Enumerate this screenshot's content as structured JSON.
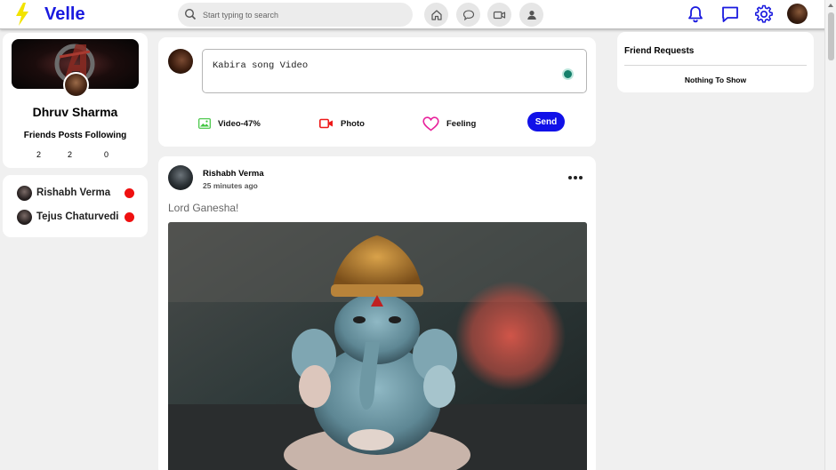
{
  "brand": {
    "name": "Velle",
    "accent": "#1a1adf"
  },
  "search": {
    "placeholder": "Start typing to search"
  },
  "nav": {
    "center_icons": [
      "home-icon",
      "chat-bubble-icon",
      "video-camera-icon",
      "user-icon"
    ],
    "right_icons": [
      "bell-icon",
      "message-square-icon",
      "gear-icon"
    ]
  },
  "profile": {
    "name": "Dhruv Sharma",
    "stats_label": "Friends Posts Following",
    "friends": "2",
    "posts": "2",
    "following": "0"
  },
  "friends_list": [
    {
      "name": "Rishabh Verma",
      "status_color": "#ef1010"
    },
    {
      "name": "Tejus Chaturvedi",
      "status_color": "#ef1010"
    }
  ],
  "composer": {
    "text": "Kabira song Video",
    "actions": {
      "video": "Video-47%",
      "photo": "Photo",
      "feeling": "Feeling"
    },
    "send_label": "Send",
    "send_color": "#1111e8"
  },
  "post": {
    "author": "Rishabh Verma",
    "time": "25 minutes ago",
    "caption": "Lord Ganesha!"
  },
  "friend_requests": {
    "title": "Friend Requests",
    "empty": "Nothing To Show"
  }
}
